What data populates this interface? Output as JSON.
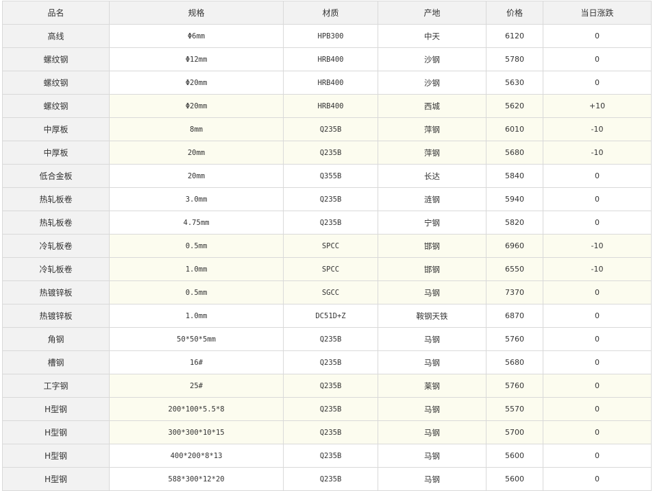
{
  "table": {
    "headers": [
      "品名",
      "规格",
      "材质",
      "产地",
      "价格",
      "当日涨跌"
    ],
    "rows": [
      {
        "name": "高线",
        "spec": "Φ6mm",
        "material": "HPB300",
        "origin": "中天",
        "price": "6120",
        "change": "0",
        "highlight": false
      },
      {
        "name": "螺纹钢",
        "spec": "Φ12mm",
        "material": "HRB400",
        "origin": "沙钢",
        "price": "5780",
        "change": "0",
        "highlight": false
      },
      {
        "name": "螺纹钢",
        "spec": "Φ20mm",
        "material": "HRB400",
        "origin": "沙钢",
        "price": "5630",
        "change": "0",
        "highlight": false
      },
      {
        "name": "螺纹钢",
        "spec": "Φ20mm",
        "material": "HRB400",
        "origin": "西城",
        "price": "5620",
        "change": "+10",
        "highlight": true
      },
      {
        "name": "中厚板",
        "spec": "8mm",
        "material": "Q235B",
        "origin": "萍钢",
        "price": "6010",
        "change": "-10",
        "highlight": true
      },
      {
        "name": "中厚板",
        "spec": "20mm",
        "material": "Q235B",
        "origin": "萍钢",
        "price": "5680",
        "change": "-10",
        "highlight": true
      },
      {
        "name": "低合金板",
        "spec": "20mm",
        "material": "Q355B",
        "origin": "长达",
        "price": "5840",
        "change": "0",
        "highlight": false
      },
      {
        "name": "热轧板卷",
        "spec": "3.0mm",
        "material": "Q235B",
        "origin": "涟钢",
        "price": "5940",
        "change": "0",
        "highlight": false
      },
      {
        "name": "热轧板卷",
        "spec": "4.75mm",
        "material": "Q235B",
        "origin": "宁钢",
        "price": "5820",
        "change": "0",
        "highlight": false
      },
      {
        "name": "冷轧板卷",
        "spec": "0.5mm",
        "material": "SPCC",
        "origin": "邯钢",
        "price": "6960",
        "change": "-10",
        "highlight": true
      },
      {
        "name": "冷轧板卷",
        "spec": "1.0mm",
        "material": "SPCC",
        "origin": "邯钢",
        "price": "6550",
        "change": "-10",
        "highlight": true
      },
      {
        "name": "热镀锌板",
        "spec": "0.5mm",
        "material": "SGCC",
        "origin": "马钢",
        "price": "7370",
        "change": "0",
        "highlight": true
      },
      {
        "name": "热镀锌板",
        "spec": "1.0mm",
        "material": "DC51D+Z",
        "origin": "鞍钢天铁",
        "price": "6870",
        "change": "0",
        "highlight": false
      },
      {
        "name": "角钢",
        "spec": "50*50*5mm",
        "material": "Q235B",
        "origin": "马钢",
        "price": "5760",
        "change": "0",
        "highlight": false
      },
      {
        "name": "槽钢",
        "spec": "16#",
        "material": "Q235B",
        "origin": "马钢",
        "price": "5680",
        "change": "0",
        "highlight": false
      },
      {
        "name": "工字钢",
        "spec": "25#",
        "material": "Q235B",
        "origin": "莱钢",
        "price": "5760",
        "change": "0",
        "highlight": true
      },
      {
        "name": "H型钢",
        "spec": "200*100*5.5*8",
        "material": "Q235B",
        "origin": "马钢",
        "price": "5570",
        "change": "0",
        "highlight": true
      },
      {
        "name": "H型钢",
        "spec": "300*300*10*15",
        "material": "Q235B",
        "origin": "马钢",
        "price": "5700",
        "change": "0",
        "highlight": true
      },
      {
        "name": "H型钢",
        "spec": "400*200*8*13",
        "material": "Q235B",
        "origin": "马钢",
        "price": "5600",
        "change": "0",
        "highlight": false
      },
      {
        "name": "H型钢",
        "spec": "588*300*12*20",
        "material": "Q235B",
        "origin": "马钢",
        "price": "5600",
        "change": "0",
        "highlight": false
      }
    ]
  }
}
